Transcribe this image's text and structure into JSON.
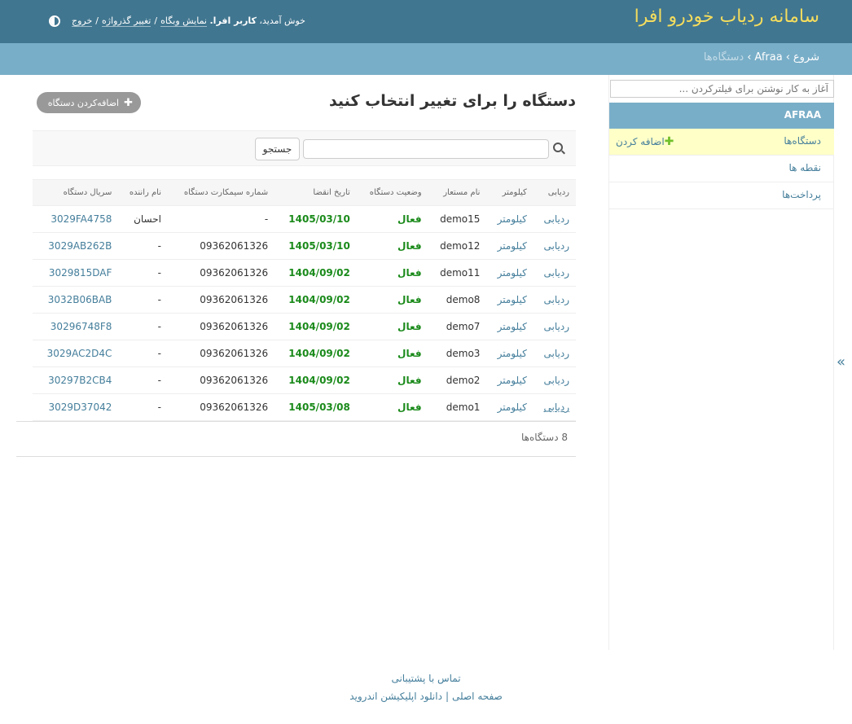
{
  "header": {
    "brand": "سامانه ردیاب خودرو افرا",
    "welcome": "خوش آمدید، ",
    "username": "کاربر افرا.",
    "view_site": "نمایش وبگاه",
    "change_password": "تغییر گذرواژه",
    "logout": "خروج",
    "separator": "/"
  },
  "breadcrumbs": {
    "home": "شروع",
    "app": "Afraa",
    "current": "دستگاه‌ها",
    "separator": "›"
  },
  "sidebar": {
    "filter_placeholder": "آغاز به کار نوشتن برای فیلترکردن ...",
    "app_caption": "AFRAA",
    "models": [
      {
        "name": "دستگاه‌ها",
        "add_label": "اضافه کردن"
      },
      {
        "name": "نقطه ها"
      },
      {
        "name": "پرداخت‌ها"
      }
    ]
  },
  "collapse_icon": "»",
  "content": {
    "title": "دستگاه را برای تغییر انتخاب کنید",
    "add_button": "اضافه‌کردن دستگاه",
    "search_button": "جستجو",
    "columns": [
      "ردیابی",
      "کیلومتر",
      "نام مستعار",
      "وضعیت دستگاه",
      "تاریخ انقضا",
      "شماره سیمکارت دستگاه",
      "نام راننده",
      "سریال دستگاه"
    ],
    "rows": [
      {
        "track": "ردیابی",
        "km": "کیلومتر",
        "alias": "demo15",
        "status": "فعال",
        "expire": "1405/03/10",
        "sim": "-",
        "driver": "احسان",
        "serial": "3029FA4758"
      },
      {
        "track": "ردیابی",
        "km": "کیلومتر",
        "alias": "demo12",
        "status": "فعال",
        "expire": "1405/03/10",
        "sim": "09362061326",
        "driver": "-",
        "serial": "3029AB262B"
      },
      {
        "track": "ردیابی",
        "km": "کیلومتر",
        "alias": "demo11",
        "status": "فعال",
        "expire": "1404/09/02",
        "sim": "09362061326",
        "driver": "-",
        "serial": "3029815DAF"
      },
      {
        "track": "ردیابی",
        "km": "کیلومتر",
        "alias": "demo8",
        "status": "فعال",
        "expire": "1404/09/02",
        "sim": "09362061326",
        "driver": "-",
        "serial": "3032B06BAB"
      },
      {
        "track": "ردیابی",
        "km": "کیلومتر",
        "alias": "demo7",
        "status": "فعال",
        "expire": "1404/09/02",
        "sim": "09362061326",
        "driver": "-",
        "serial": "30296748F8"
      },
      {
        "track": "ردیابی",
        "km": "کیلومتر",
        "alias": "demo3",
        "status": "فعال",
        "expire": "1404/09/02",
        "sim": "09362061326",
        "driver": "-",
        "serial": "3029AC2D4C"
      },
      {
        "track": "ردیابی",
        "km": "کیلومتر",
        "alias": "demo2",
        "status": "فعال",
        "expire": "1404/09/02",
        "sim": "09362061326",
        "driver": "-",
        "serial": "30297B2CB4"
      },
      {
        "track": "ردیابی",
        "km": "کیلومتر",
        "alias": "demo1",
        "status": "فعال",
        "expire": "1405/03/08",
        "sim": "09362061326",
        "driver": "-",
        "serial": "3029D37042"
      }
    ],
    "paginator": "8 دستگاه‌ها"
  },
  "footer": {
    "support": "تماس با پشتیبانی",
    "home": "صفحه اصلی",
    "separator": "|",
    "android": "دانلود اپلیکیشن اندروید"
  },
  "colors": {
    "header_bg": "#417690",
    "brand": "#f5dd5d",
    "breadcrumbs_bg": "#79aec8",
    "link": "#447e9b",
    "active_status": "#1a8a1a",
    "current_model_bg": "#ffffc8"
  }
}
